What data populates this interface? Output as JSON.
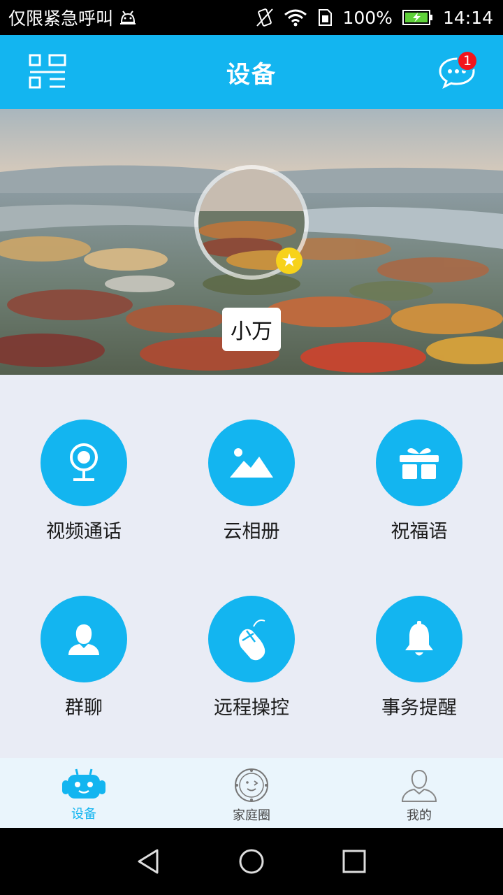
{
  "status_bar": {
    "carrier_text": "仅限紧急呼叫",
    "battery": "100%",
    "time": "14:14",
    "icons": [
      "android-debug-icon",
      "vibrate-icon",
      "wifi-icon",
      "sim-icon",
      "battery-charging-icon"
    ]
  },
  "header": {
    "title": "设备",
    "left_icon": "scan-icon",
    "right_icon": "message-bubble-icon",
    "message_badge": "1"
  },
  "hero": {
    "device_name": "小万",
    "badge_icon": "star-icon"
  },
  "features": [
    {
      "label": "视频通话",
      "icon": "webcam-icon"
    },
    {
      "label": "云相册",
      "icon": "picture-icon"
    },
    {
      "label": "祝福语",
      "icon": "gift-icon"
    },
    {
      "label": "群聊",
      "icon": "user-icon"
    },
    {
      "label": "远程操控",
      "icon": "mouse-icon"
    },
    {
      "label": "事务提醒",
      "icon": "bell-icon"
    }
  ],
  "tabs": [
    {
      "label": "设备",
      "icon": "robot-icon",
      "active": true
    },
    {
      "label": "家庭圈",
      "icon": "family-circle-icon",
      "active": false
    },
    {
      "label": "我的",
      "icon": "profile-icon",
      "active": false
    }
  ],
  "navigation": {
    "buttons": [
      "back-icon",
      "home-icon",
      "recents-icon"
    ]
  },
  "colors": {
    "accent": "#13b5f0",
    "badge": "#f3141c",
    "star": "#f7d21b",
    "background": "#e9ecf5"
  }
}
